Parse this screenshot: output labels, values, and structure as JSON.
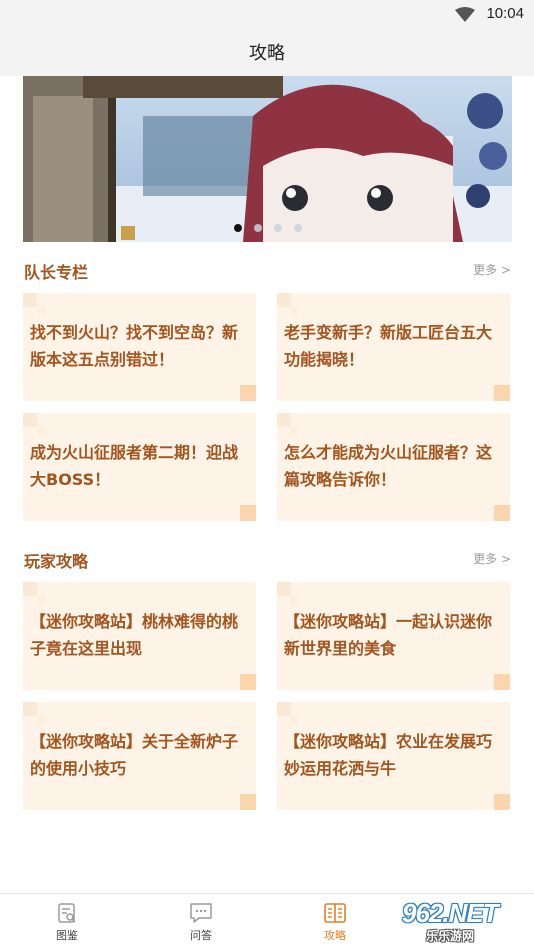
{
  "status_bar": {
    "time": "10:04"
  },
  "header": {
    "title": "攻略"
  },
  "banner": {
    "slide_count": 4,
    "active_index": 0
  },
  "sections": [
    {
      "title": "队长专栏",
      "more_label": "更多 >",
      "cards": [
        {
          "title": "找不到火山？找不到空岛？新版本这五点别错过！"
        },
        {
          "title": "老手变新手？新版工匠台五大功能揭晓！"
        },
        {
          "title": "成为火山征服者第二期！迎战大BOSS！"
        },
        {
          "title": "怎么才能成为火山征服者？这篇攻略告诉你！"
        }
      ]
    },
    {
      "title": "玩家攻略",
      "more_label": "更多 >",
      "cards": [
        {
          "title": "【迷你攻略站】桃林难得的桃子竟在这里出现"
        },
        {
          "title": "【迷你攻略站】一起认识迷你新世界里的美食"
        },
        {
          "title": "【迷你攻略站】关于全新炉子的使用小技巧"
        },
        {
          "title": "【迷你攻略站】农业在发展巧妙运用花洒与牛"
        }
      ]
    }
  ],
  "tab_bar": {
    "tabs": [
      {
        "label": "图鉴",
        "icon": "encyclopedia-icon"
      },
      {
        "label": "问答",
        "icon": "chat-bubble-icon"
      },
      {
        "label": "攻略",
        "icon": "book-icon",
        "active": true
      }
    ]
  },
  "watermark": {
    "main": "962.NET",
    "sub": "乐乐游网"
  },
  "colors": {
    "accent": "#e67f22",
    "section_text": "#a2551f",
    "card_bg": "#fdf3e6",
    "card_corner": "#fbd6ac"
  }
}
